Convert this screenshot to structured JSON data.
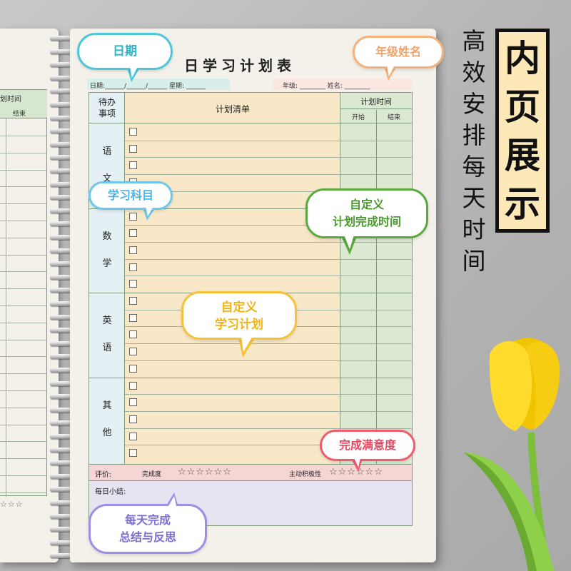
{
  "left_page": {
    "header_title": "划时间",
    "header_sub": "结束",
    "stars": "☆☆☆"
  },
  "page": {
    "title": "日学习计划表",
    "date_line": "日期:______/______/______  星期: ______",
    "name_line": "年级: ________   姓名: ________"
  },
  "table": {
    "head_todo": "待办\n事项",
    "head_list": "计划清单",
    "head_time": "计划时间",
    "head_start": "开始",
    "head_end": "结束",
    "subjects": [
      {
        "name": "语\n文"
      },
      {
        "name": "数\n学"
      },
      {
        "name": "英\n语"
      },
      {
        "name": "其\n他"
      }
    ],
    "rating_label": "评价:",
    "completion_label": "完成度",
    "completion_stars": "☆☆☆☆☆☆",
    "initiative_label": "主动积极性",
    "initiative_stars": "☆☆☆☆☆☆",
    "summary_label": "每日小结:"
  },
  "bubbles": {
    "date": "日期",
    "grade_name": "年级姓名",
    "subject": "学习科目",
    "time_line1": "自定义",
    "time_line2": "计划完成时间",
    "plan_line1": "自定义",
    "plan_line2": "学习计划",
    "satisfaction": "完成满意度",
    "summary_line1": "每天完成",
    "summary_line2": "总结与反思"
  },
  "headline": {
    "chars": [
      "内",
      "页",
      "展",
      "示"
    ],
    "vertical_chars": [
      "高",
      "效",
      "安",
      "排",
      "每",
      "天",
      "时",
      "间"
    ]
  },
  "colors": {
    "subject_column": "#e5f0f4",
    "list_column": "#f8e8c8",
    "time_column": "#dbe9d3",
    "rating_row": "#f6d5d5",
    "summary_row": "#e6e4f0",
    "headline_bg": "#fde9b8"
  }
}
